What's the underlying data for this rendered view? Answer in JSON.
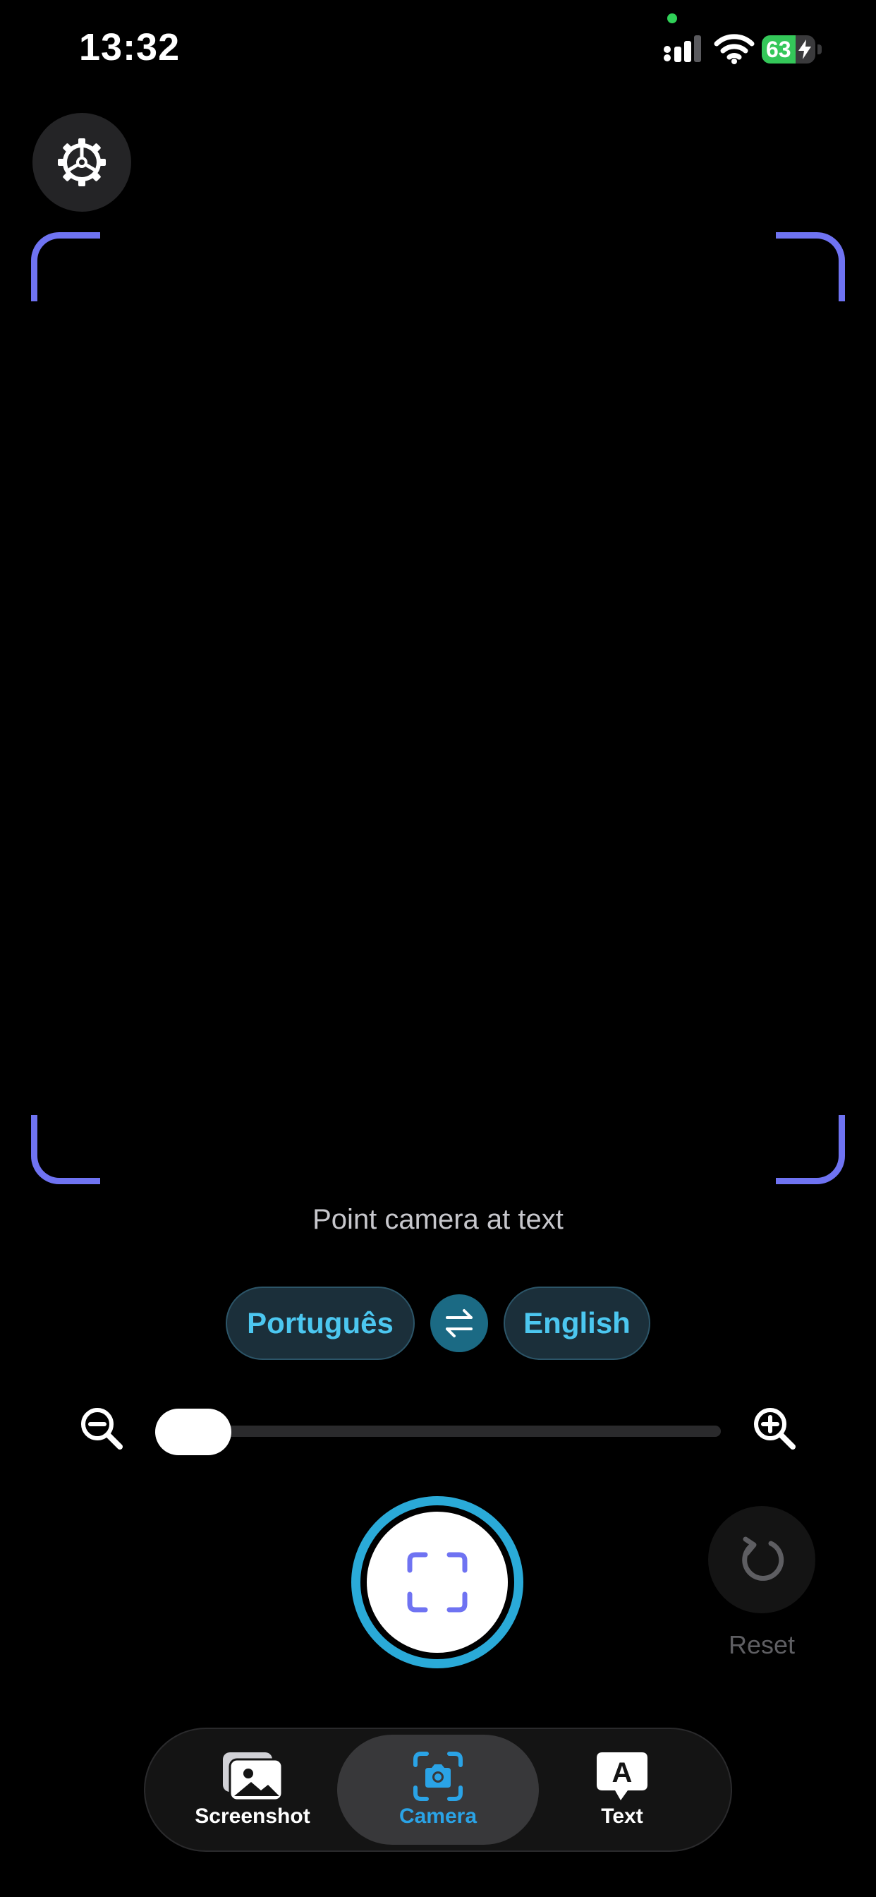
{
  "status_bar": {
    "time": "13:32",
    "battery_level": "63",
    "battery_percent": 63,
    "charging": true
  },
  "settings": {
    "icon": "gear-icon"
  },
  "viewfinder": {
    "corner_color": "#6f73f2",
    "hint": "Point camera at text"
  },
  "languages": {
    "source": "Português",
    "target": "English",
    "swap_icon": "swap-arrows-icon"
  },
  "zoom": {
    "level": 0,
    "out_icon": "zoom-out-icon",
    "in_icon": "zoom-in-icon"
  },
  "shutter": {
    "icon": "scan-frame-icon",
    "ring_color": "#2aaad8"
  },
  "reset": {
    "label": "Reset",
    "icon": "reset-icon"
  },
  "tabs": [
    {
      "label": "Screenshot",
      "icon": "photo-icon",
      "active": false
    },
    {
      "label": "Camera",
      "icon": "camera-scan-icon",
      "active": true
    },
    {
      "label": "Text",
      "icon": "text-bubble-icon",
      "active": false
    }
  ],
  "colors": {
    "accent": "#2aa3e6",
    "language_text": "#4cc7f0",
    "battery_green": "#34c759"
  }
}
